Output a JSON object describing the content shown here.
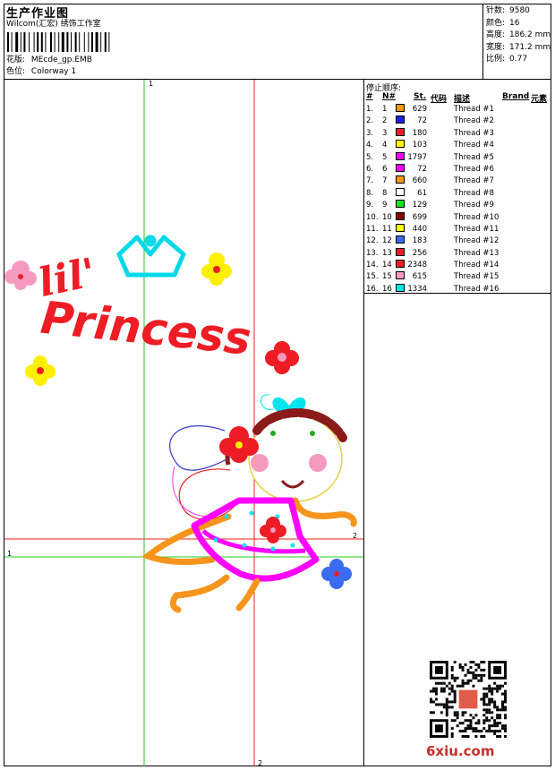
{
  "header": {
    "title": "生产作业图",
    "company": "Wilcom(汇宏) 绣饰工作室",
    "pattern_label": "花版:",
    "pattern_value": "MEcde_gp.EMB",
    "colorway_label": "色位:",
    "colorway_value": "Colorway 1"
  },
  "stats": [
    {
      "label": "针数:",
      "value": "9580"
    },
    {
      "label": "颜色:",
      "value": "16"
    },
    {
      "label": "高度:",
      "value": "186.2 mm"
    },
    {
      "label": "宽度:",
      "value": "171.2 mm"
    },
    {
      "label": "比例:",
      "value": "0.77"
    }
  ],
  "thread_panel": {
    "stop_title": "停止顺序:",
    "headers": {
      "num": "#",
      "n": "N#",
      "st": "St.",
      "code": "代码",
      "desc": "描述",
      "brand": "Brand",
      "elem": "元素"
    },
    "rows": [
      {
        "idx": "1.",
        "n": "1",
        "color": "#f7941d",
        "st": "629",
        "desc": "Thread #1"
      },
      {
        "idx": "2.",
        "n": "2",
        "color": "#1f1fe0",
        "st": "72",
        "desc": "Thread #2"
      },
      {
        "idx": "3.",
        "n": "3",
        "color": "#ee1c24",
        "st": "180",
        "desc": "Thread #3"
      },
      {
        "idx": "4.",
        "n": "4",
        "color": "#ffff00",
        "st": "103",
        "desc": "Thread #4"
      },
      {
        "idx": "5.",
        "n": "5",
        "color": "#ff00ff",
        "st": "1797",
        "desc": "Thread #5"
      },
      {
        "idx": "6.",
        "n": "6",
        "color": "#ff00ff",
        "st": "72",
        "desc": "Thread #6"
      },
      {
        "idx": "7.",
        "n": "7",
        "color": "#f7941d",
        "st": "660",
        "desc": "Thread #7"
      },
      {
        "idx": "8.",
        "n": "8",
        "color": "#ffffff",
        "st": "61",
        "desc": "Thread #8"
      },
      {
        "idx": "9.",
        "n": "9",
        "color": "#22dd22",
        "st": "129",
        "desc": "Thread #9"
      },
      {
        "idx": "10.",
        "n": "10",
        "color": "#8b0000",
        "st": "699",
        "desc": "Thread #10"
      },
      {
        "idx": "11.",
        "n": "11",
        "color": "#ffff00",
        "st": "440",
        "desc": "Thread #11"
      },
      {
        "idx": "12.",
        "n": "12",
        "color": "#3a6bf0",
        "st": "183",
        "desc": "Thread #12"
      },
      {
        "idx": "13.",
        "n": "13",
        "color": "#ee1c24",
        "st": "256",
        "desc": "Thread #13"
      },
      {
        "idx": "14.",
        "n": "14",
        "color": "#ee1c24",
        "st": "2348",
        "desc": "Thread #14"
      },
      {
        "idx": "15.",
        "n": "15",
        "color": "#f49ac1",
        "st": "615",
        "desc": "Thread #15"
      },
      {
        "idx": "16.",
        "n": "16",
        "color": "#00e5ee",
        "st": "1334",
        "desc": "Thread #16"
      }
    ]
  },
  "design": {
    "text_lil": "lil'",
    "text_princess": "Princess",
    "guide_label_v_green": "1",
    "guide_label_h_green": "1",
    "guide_label_v_red": "2",
    "guide_label_h_red": "2",
    "guide_green_color": "#22cc22",
    "guide_red_color": "#ee2222"
  },
  "watermark": "6xiu.com"
}
